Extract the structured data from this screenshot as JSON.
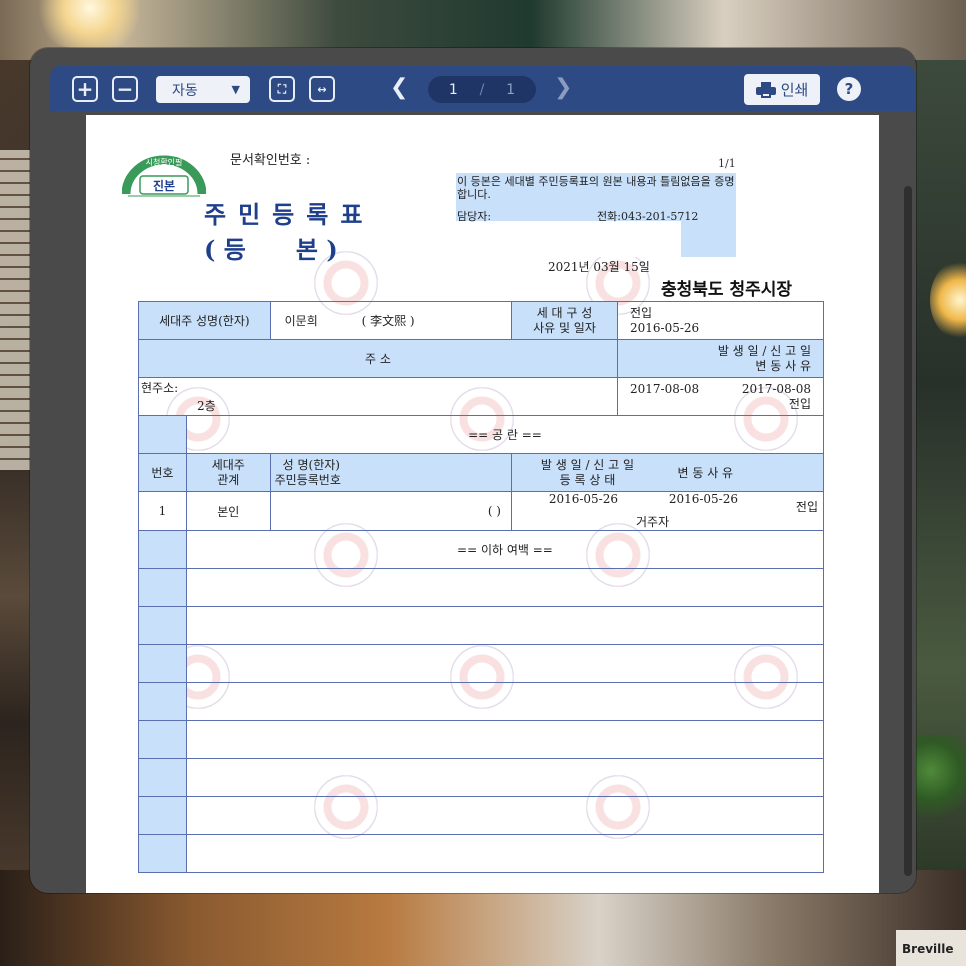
{
  "toolbar": {
    "zoom_in_symbol": "+",
    "zoom_out_symbol": "−",
    "zoom_mode": "자동",
    "fit_page_symbol": "⛶",
    "fit_width_symbol": "↔",
    "prev_symbol": "❮",
    "next_symbol": "❯",
    "current_page": "1",
    "page_separator": "/",
    "total_pages": "1",
    "print_label": "인쇄",
    "help_symbol": "?"
  },
  "icons": [
    "zoom-in-icon",
    "zoom-out-icon",
    "chevron-down-icon",
    "fit-page-icon",
    "fit-width-icon",
    "chevron-left-icon",
    "chevron-right-icon",
    "printer-icon",
    "help-icon"
  ],
  "colors": {
    "toolbar": "#2e4a85",
    "header_fill": "#c8e0fa",
    "title": "#1e3f8c"
  },
  "document": {
    "seal_top": "시청확인필",
    "seal_main": "진본",
    "doc_number_label": "문서확인번호 :",
    "page_count": "1/1",
    "title_line1": "주민등록표",
    "title_line2": "( 등      본 )",
    "certification": "이 등본은 세대별 주민등록표의 원본 내용과 틀림없음을 증명합니다.",
    "officer_label": "담당자:",
    "phone": "전화:043-201-5712",
    "issue_date": "2021년 03월 15일",
    "issuer": "충청북도 청주시장"
  },
  "table": {
    "head_label": "세대주 성명(한자)",
    "head_name": "이문희",
    "head_hanja": "( 李文熙        )",
    "composition_reason_label": "세 대 구 성",
    "composition_reason_label2": "사유 및 일자",
    "composition_reason": "전입",
    "composition_date": "2016-05-26",
    "address_label": "주                  소",
    "date_header_line1": "발 생 일  /  신 고 일",
    "date_header_line2": "변       동       사       유",
    "current_address_label": "현주소:",
    "address_detail": "2층",
    "occurred_date": "2017-08-08",
    "reported_date": "2017-08-08",
    "address_change_reason": "전입",
    "blank_marker": "==     공     란     ==",
    "col_number": "번호",
    "col_relation_line1": "세대주",
    "col_relation_line2": "관계",
    "col_name_line1": "성 명(한자)",
    "col_name_line2": "주민등록번호",
    "col_dates_line1": "발 생 일  /  신 고 일",
    "col_dates_line2": "등 록 상 태",
    "col_reason": "변 동 사 유",
    "members": [
      {
        "number": "1",
        "relation": "본인",
        "hanja": "(        )",
        "occurred_date": "2016-05-26",
        "reported_date": "2016-05-26",
        "status": "거주자",
        "reason": "전입"
      }
    ],
    "end_marker": "== 이하 여백 =="
  }
}
